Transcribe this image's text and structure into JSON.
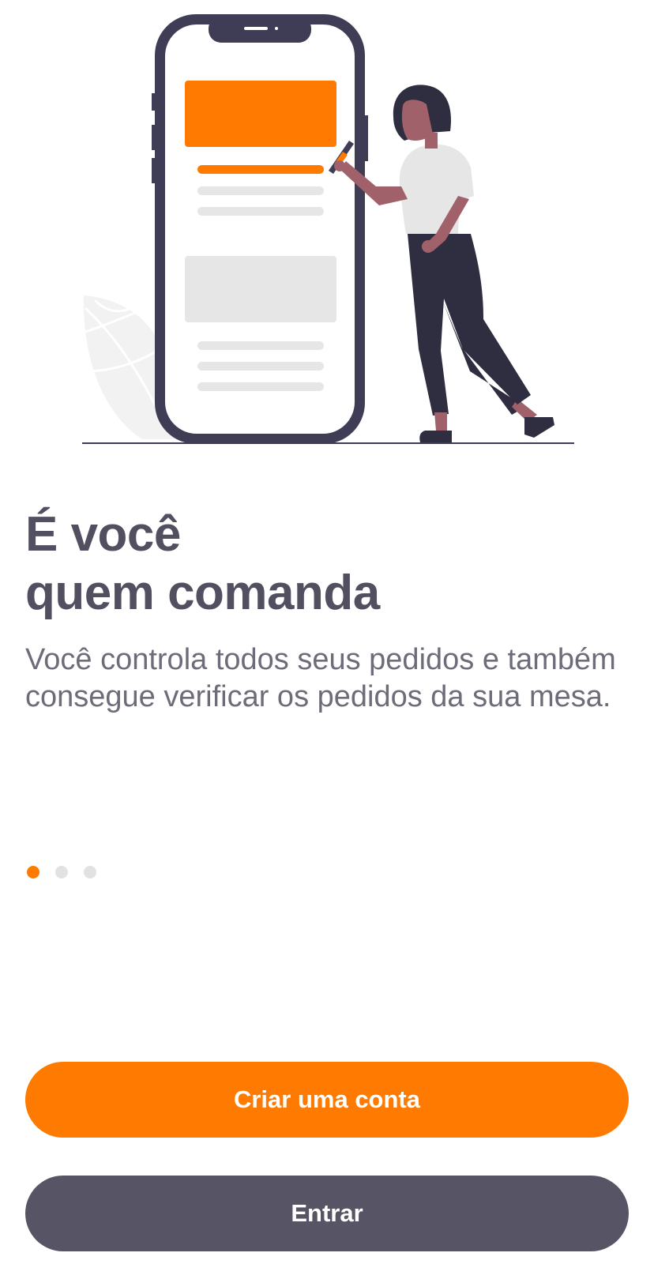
{
  "onboarding": {
    "title_line1": "É você",
    "title_line2": "quem comanda",
    "description": "Você controla todos seus pedidos e também consegue verificar os pedidos da sua mesa.",
    "pagination": {
      "total_pages": 3,
      "active_page": 1
    }
  },
  "actions": {
    "create_account_label": "Criar uma conta",
    "login_label": "Entrar"
  },
  "colors": {
    "accent": "#ff7a00",
    "dark": "#3f3d56",
    "secondary_button": "#575565",
    "text": "#525060",
    "skin": "#a0616a",
    "placeholder_gray": "#e6e6e6"
  },
  "illustration": {
    "icon": "person-with-phone-illustration"
  }
}
